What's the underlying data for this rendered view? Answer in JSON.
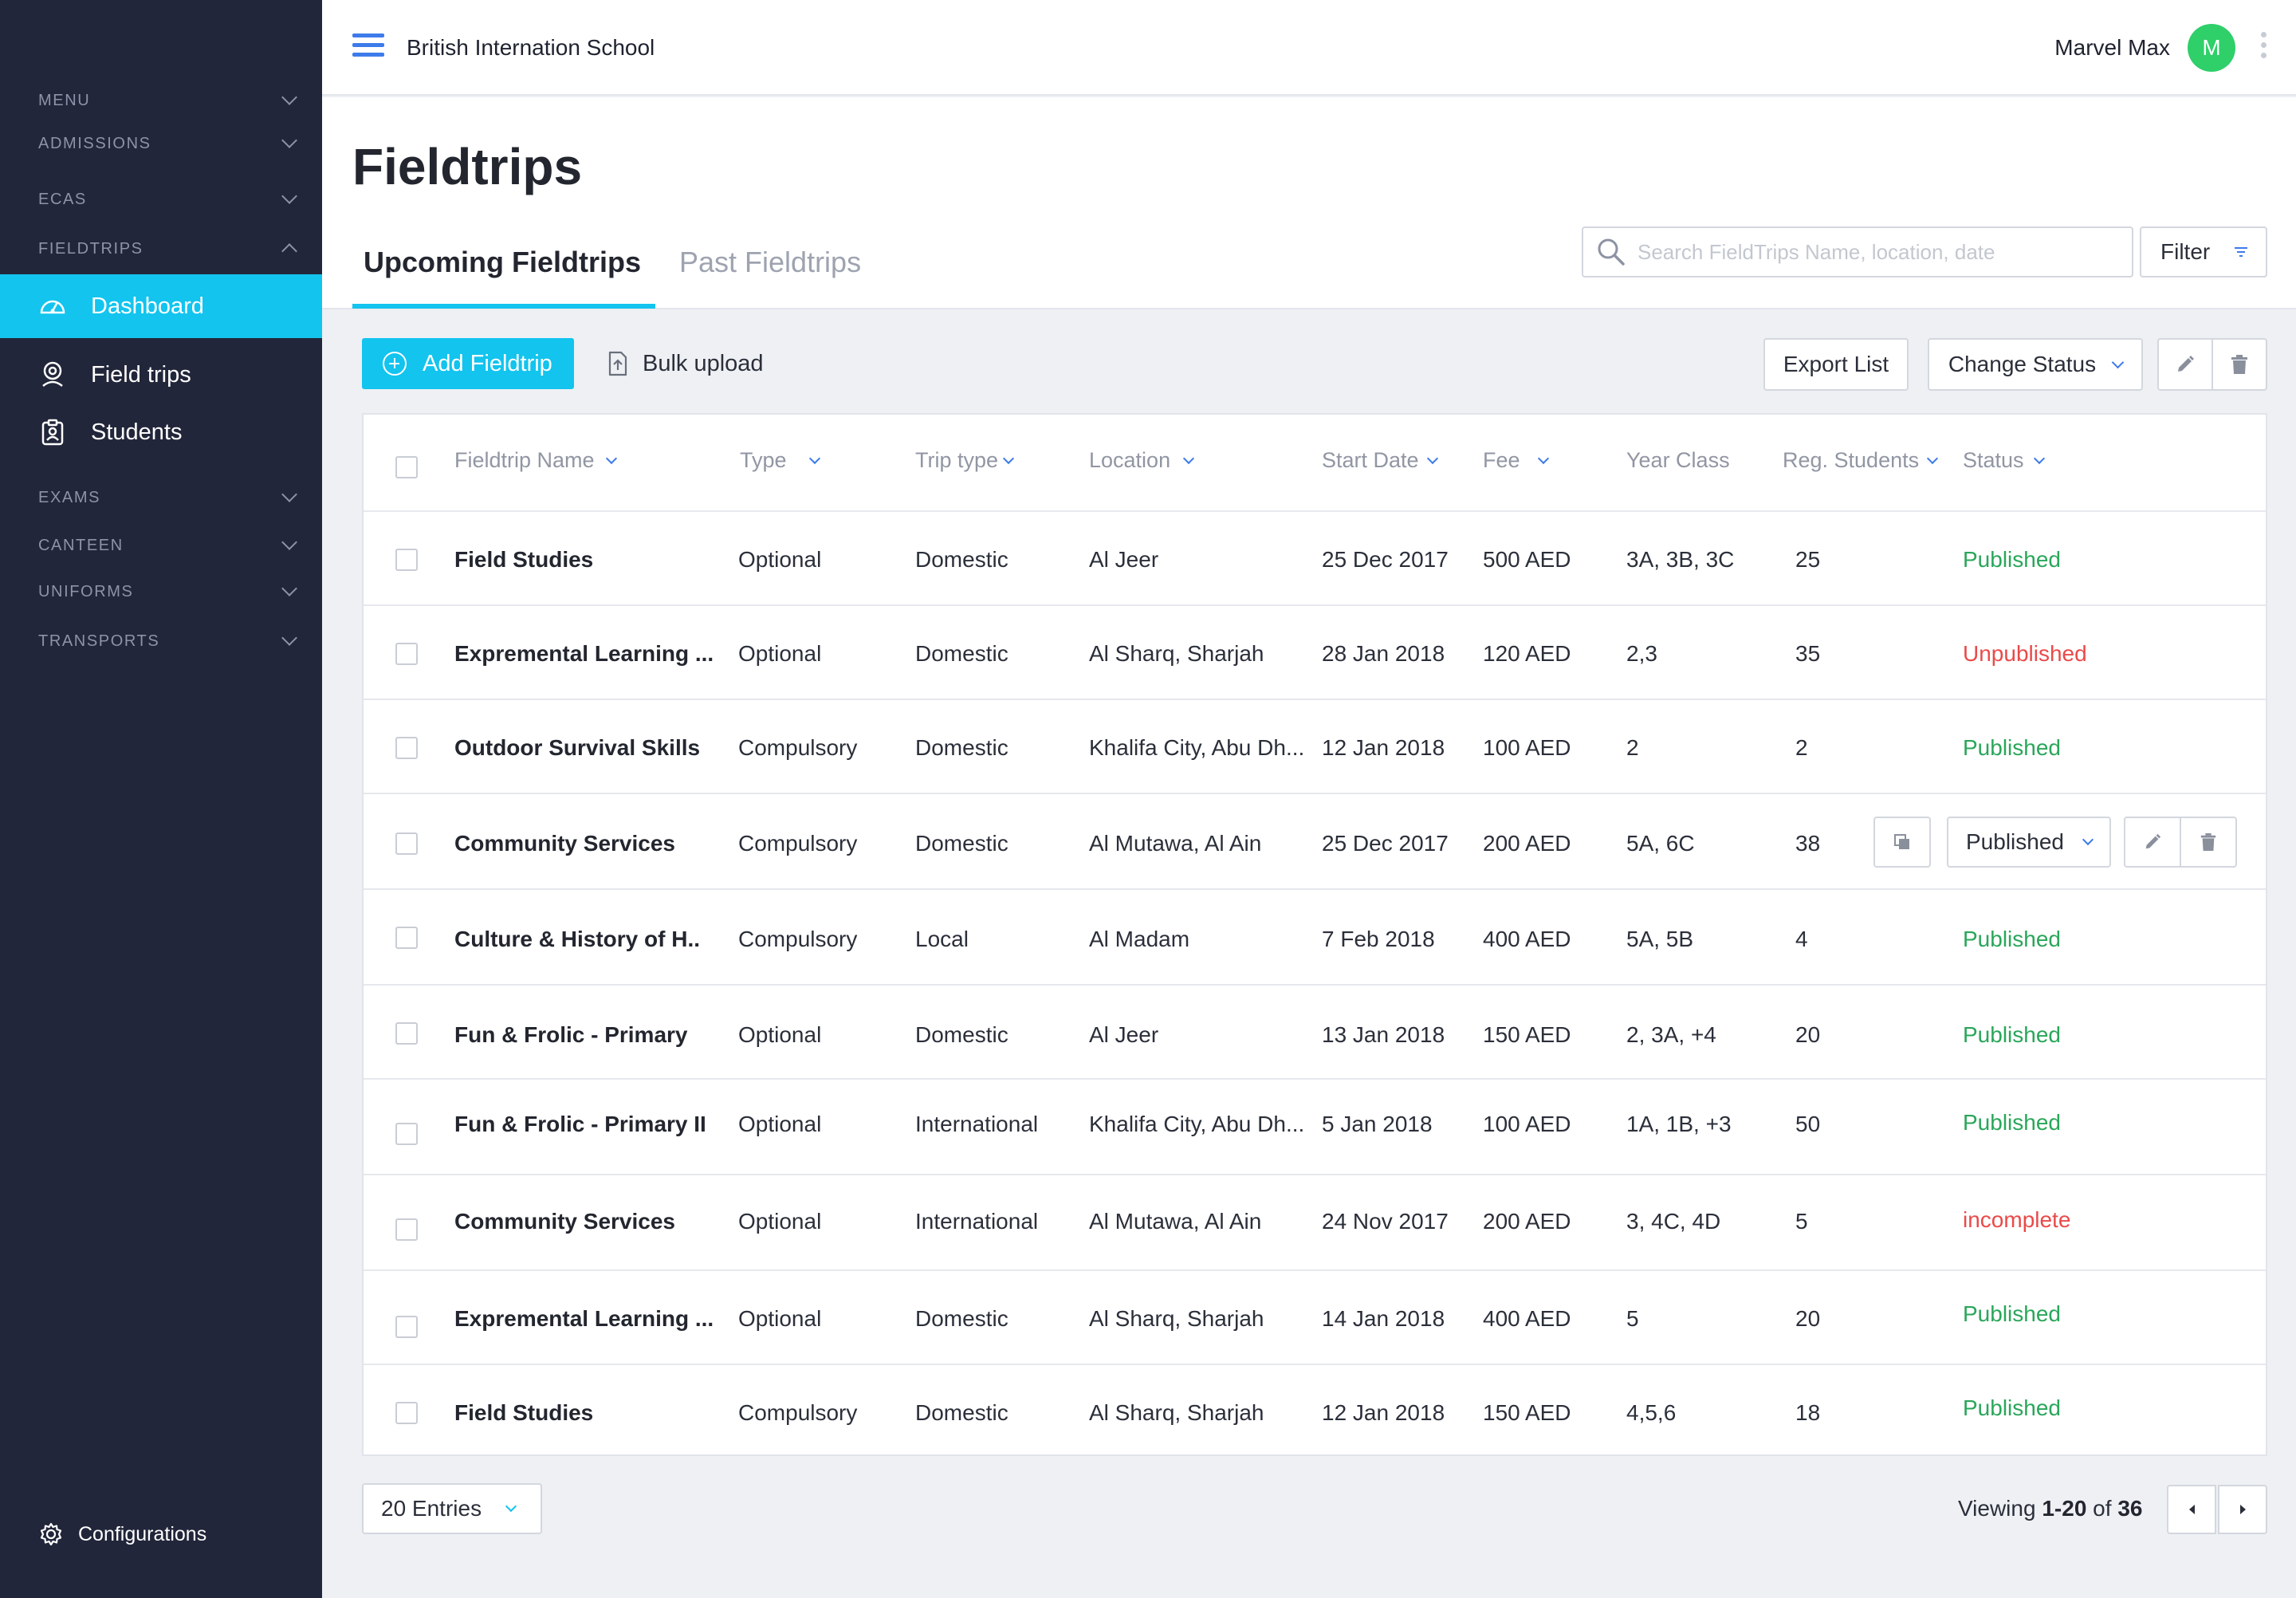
{
  "sidebar": {
    "sections": [
      "MENU",
      "ADMISSIONS",
      "ECAS",
      "FIELDTRIPS",
      "EXAMS",
      "CANTEEN",
      "UNIFORMS",
      "TRANSPORTS"
    ],
    "nav": [
      {
        "label": "Dashboard",
        "icon": "dashboard-icon",
        "active": true
      },
      {
        "label": "Field trips",
        "icon": "location-pin-icon"
      },
      {
        "label": "Students",
        "icon": "student-badge-icon"
      }
    ],
    "configurations": "Configurations"
  },
  "topbar": {
    "school": "British Internation School",
    "user": "Marvel Max",
    "avatar_initial": "M",
    "avatar_color": "#2fcf6a"
  },
  "page": {
    "title": "Fieldtrips",
    "tabs": [
      "Upcoming Fieldtrips",
      "Past Fieldtrips"
    ],
    "search_placeholder": "Search FieldTrips Name, location, date",
    "filter_label": "Filter"
  },
  "toolbar": {
    "add": "Add Fieldtrip",
    "bulk": "Bulk upload",
    "export": "Export List",
    "change_status": "Change Status"
  },
  "table": {
    "headers": {
      "name": "Fieldtrip Name",
      "type": "Type",
      "trip_type": "Trip type",
      "location": "Location",
      "start_date": "Start Date",
      "fee": "Fee",
      "year_class": "Year Class",
      "reg_students": "Reg. Students",
      "status": "Status"
    },
    "rows": [
      {
        "name": "Field Studies",
        "type": "Optional",
        "trip_type": "Domestic",
        "location": "Al Jeer",
        "start_date": "25 Dec 2017",
        "fee": "500 AED",
        "year_class": "3A, 3B, 3C",
        "students": "25",
        "status": "Published"
      },
      {
        "name": "Expremental Learning ...",
        "type": "Optional",
        "trip_type": "Domestic",
        "location": "Al Sharq, Sharjah",
        "start_date": "28 Jan 2018",
        "fee": "120 AED",
        "year_class": "2,3",
        "students": "35",
        "status": "Unpublished"
      },
      {
        "name": "Outdoor Survival Skills",
        "type": "Compulsory",
        "trip_type": "Domestic",
        "location": "Khalifa City, Abu Dh...",
        "start_date": "12 Jan 2018",
        "fee": "100 AED",
        "year_class": "2",
        "students": "2",
        "status": "Published"
      },
      {
        "name": "Community Services",
        "type": "Compulsory",
        "trip_type": "Domestic",
        "location": "Al Mutawa, Al Ain",
        "start_date": "25 Dec 2017",
        "fee": "200 AED",
        "year_class": "5A, 6C",
        "students": "38",
        "status": "Published"
      },
      {
        "name": "Culture & History of H..",
        "type": "Compulsory",
        "trip_type": "Local",
        "location": "Al Madam",
        "start_date": "7 Feb 2018",
        "fee": "400 AED",
        "year_class": "5A, 5B",
        "students": "4",
        "status": "Published"
      },
      {
        "name": "Fun & Frolic - Primary",
        "type": "Optional",
        "trip_type": "Domestic",
        "location": "Al Jeer",
        "start_date": "13 Jan 2018",
        "fee": "150 AED",
        "year_class": "2, 3A, +4",
        "students": "20",
        "status": "Published"
      },
      {
        "name": "Fun & Frolic - Primary II",
        "type": "Optional",
        "trip_type": "International",
        "location": "Khalifa City, Abu Dh...",
        "start_date": "5 Jan 2018",
        "fee": "100 AED",
        "year_class": "1A, 1B, +3",
        "students": "50",
        "status": "Published"
      },
      {
        "name": "Community Services",
        "type": "Optional",
        "trip_type": "International",
        "location": "Al Mutawa, Al Ain",
        "start_date": "24 Nov 2017",
        "fee": "200 AED",
        "year_class": "3, 4C, 4D",
        "students": "5",
        "status": "incomplete"
      },
      {
        "name": "Expremental Learning ...",
        "type": "Optional",
        "trip_type": "Domestic",
        "location": "Al Sharq, Sharjah",
        "start_date": "14 Jan 2018",
        "fee": "400 AED",
        "year_class": "5",
        "students": "20",
        "status": "Published"
      },
      {
        "name": "Field Studies",
        "type": "Compulsory",
        "trip_type": "Domestic",
        "location": "Al Sharq, Sharjah",
        "start_date": "12 Jan 2018",
        "fee": "150 AED",
        "year_class": "4,5,6",
        "students": "18",
        "status": "Published"
      }
    ]
  },
  "footer": {
    "entries": "20 Entries",
    "viewing_prefix": "Viewing",
    "viewing_range": "1-20",
    "viewing_of": "of",
    "viewing_total": "36"
  },
  "colors": {
    "accent": "#12c4ee",
    "link": "#3d7bea",
    "published": "#2aa65a",
    "unpublished": "#ea4a4a",
    "sidebar": "#22263a"
  }
}
